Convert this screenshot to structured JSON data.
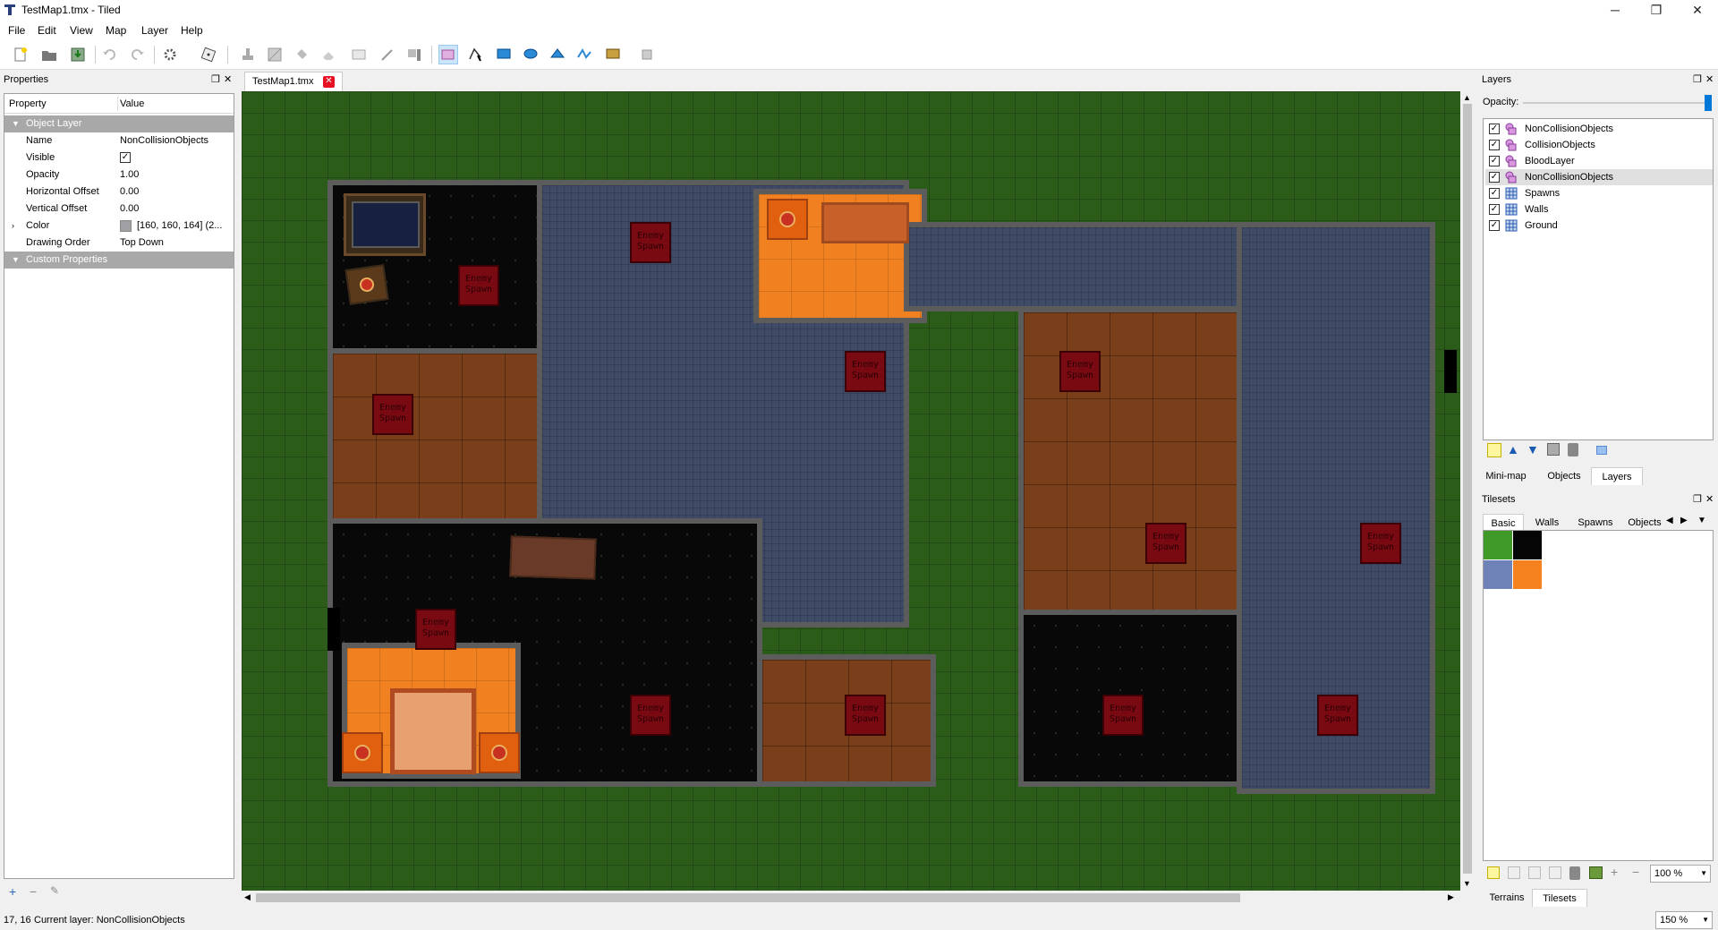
{
  "window": {
    "title": "TestMap1.tmx - Tiled",
    "minimize": "─",
    "maximize": "❐",
    "close": "✕"
  },
  "menu": [
    "File",
    "Edit",
    "View",
    "Map",
    "Layer",
    "Help"
  ],
  "toolbar": {
    "icons": [
      "new-map-icon",
      "open-icon",
      "save-icon",
      "undo-icon",
      "redo-icon",
      "command-icon",
      "random-mode-icon",
      "stamp-brush-icon",
      "terrain-brush-icon",
      "bucket-fill-icon",
      "eraser-icon",
      "rectangular-select-icon",
      "magic-wand-icon",
      "select-same-tile-icon",
      "select-objects-icon",
      "edit-polygons-icon",
      "insert-rectangle-icon",
      "insert-ellipse-icon",
      "insert-polygon-icon",
      "insert-polyline-icon",
      "insert-tile-icon",
      "insert-template-icon"
    ],
    "active": "select-objects-icon"
  },
  "properties": {
    "panel_title": "Properties",
    "col_property": "Property",
    "col_value": "Value",
    "section_object_layer": "Object Layer",
    "section_custom": "Custom Properties",
    "rows": [
      {
        "key": "Name",
        "value": "NonCollisionObjects"
      },
      {
        "key": "Visible",
        "value": "✓"
      },
      {
        "key": "Opacity",
        "value": "1.00"
      },
      {
        "key": "Horizontal Offset",
        "value": "0.00"
      },
      {
        "key": "Vertical Offset",
        "value": "0.00"
      },
      {
        "key": "Color",
        "value": "[160, 160, 164] (2..."
      },
      {
        "key": "Drawing Order",
        "value": "Top Down"
      }
    ],
    "color_swatch": "#a0a0a4"
  },
  "document": {
    "tab_label": "TestMap1.tmx",
    "close": "✕"
  },
  "map": {
    "spawn_label": "Enemy Spawn",
    "colors": {
      "grass": "#2c5c1a",
      "wall": "#5c5c5c",
      "spawn": "#7a0a12"
    }
  },
  "layers": {
    "panel_title": "Layers",
    "opacity_label": "Opacity:",
    "opacity_value": 1.0,
    "items": [
      {
        "name": "NonCollisionObjects",
        "kind": "object-layer-icon",
        "visible": true,
        "selected": false
      },
      {
        "name": "CollisionObjects",
        "kind": "object-layer-icon",
        "visible": true,
        "selected": false
      },
      {
        "name": "BloodLayer",
        "kind": "object-layer-icon",
        "visible": true,
        "selected": false
      },
      {
        "name": "NonCollisionObjects",
        "kind": "object-layer-icon",
        "visible": true,
        "selected": true
      },
      {
        "name": "Spawns",
        "kind": "tile-layer-icon",
        "visible": true,
        "selected": false
      },
      {
        "name": "Walls",
        "kind": "tile-layer-icon",
        "visible": true,
        "selected": false
      },
      {
        "name": "Ground",
        "kind": "tile-layer-icon",
        "visible": true,
        "selected": false
      }
    ],
    "tabs": [
      "Mini-map",
      "Objects",
      "Layers"
    ],
    "active_tab": "Layers"
  },
  "tilesets": {
    "panel_title": "Tilesets",
    "tabs": [
      "Basic",
      "Walls",
      "Spawns",
      "Objects"
    ],
    "active_tab": "Basic",
    "zoom": "100 %",
    "bottom_tabs": [
      "Terrains",
      "Tilesets"
    ],
    "active_bottom": "Tilesets",
    "tiles": [
      "#3f9a2a",
      "#050505",
      "#6e82b8",
      "#f5821f"
    ]
  },
  "status": {
    "coords": "17, 16",
    "current_layer": "Current layer: NonCollisionObjects",
    "zoom": "150 %"
  }
}
